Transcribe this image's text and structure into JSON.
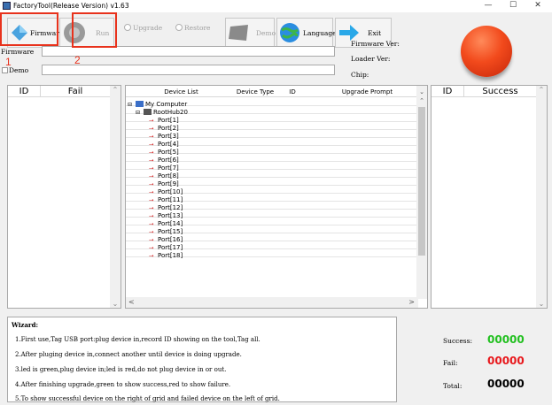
{
  "window": {
    "title": "FactoryTool(Release Version) v1.63"
  },
  "toolbar": {
    "firmware": "Firmware",
    "run": "Run",
    "upgrade": "Upgrade",
    "restore": "Restore",
    "demo": "Demo",
    "language": "Language",
    "exit": "Exit"
  },
  "fields": {
    "firmware_label": "Firmware",
    "firmware_value": "",
    "demo_label": "Demo",
    "demo_value": ""
  },
  "info": {
    "firmware_ver": "Firmware Ver:",
    "loader_ver": "Loader Ver:",
    "chip": "Chip:"
  },
  "annotations": {
    "one": "1",
    "two": "2"
  },
  "fail_grid": {
    "headers": [
      "ID",
      "Fail"
    ]
  },
  "success_grid": {
    "headers": [
      "ID",
      "Success"
    ]
  },
  "device_list": {
    "headers": [
      "Device List",
      "Device Type",
      "ID",
      "Upgrade Prompt"
    ],
    "root": "My Computer",
    "hub": "RootHub20",
    "ports": [
      "Port[1]",
      "Port[2]",
      "Port[3]",
      "Port[4]",
      "Port[5]",
      "Port[6]",
      "Port[7]",
      "Port[8]",
      "Port[9]",
      "Port[10]",
      "Port[11]",
      "Port[12]",
      "Port[13]",
      "Port[14]",
      "Port[15]",
      "Port[16]",
      "Port[17]",
      "Port[18]"
    ]
  },
  "wizard": {
    "title": "Wizard:",
    "lines": [
      "1.First use,Tag USB port:plug device in,record ID showing on the tool,Tag all.",
      "2.After pluging device in,connect another until device is doing upgrade.",
      "3.led is green,plug device in;led is red,do not plug device in or out.",
      "4.After finishing upgrade,green to show success,red to show failure.",
      "5.To show successful device on the right of grid and failed device on the left of grid."
    ]
  },
  "stats": {
    "success_label": "Success:",
    "success_value": "00000",
    "fail_label": "Fail:",
    "fail_value": "00000",
    "total_label": "Total:",
    "total_value": "00000"
  },
  "colors": {
    "success": "#22c020",
    "fail": "#e8181c",
    "annotation": "#e8321c",
    "status_button": "#f24a1c"
  },
  "icons": {
    "firmware": "diamond-icon",
    "run": "gear-icon",
    "demo": "book-icon",
    "language": "globe-icon",
    "exit": "arrow-right-icon",
    "port": "usb-icon"
  }
}
